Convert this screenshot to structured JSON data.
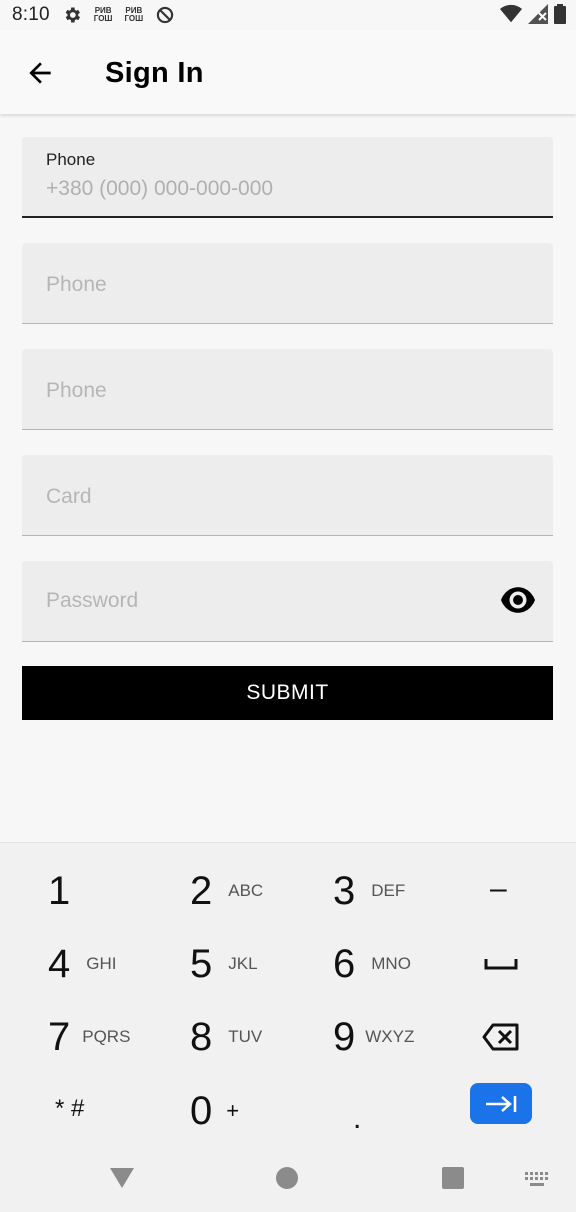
{
  "status_bar": {
    "time": "8:10",
    "icons": [
      "gear-icon",
      "sim-icon",
      "sim-icon",
      "no-sync-icon",
      "wifi-icon",
      "signal-icon",
      "battery-icon"
    ],
    "sim_label_top": "PИВ",
    "sim_label_bottom": "ГОШ"
  },
  "app_bar": {
    "title": "Sign In",
    "back_icon": "arrow-left-icon"
  },
  "form": {
    "phone_focused": {
      "label": "Phone",
      "value": "+380 (000) 000-000-000"
    },
    "phone_2": {
      "placeholder": "Phone"
    },
    "phone_3": {
      "placeholder": "Phone"
    },
    "card": {
      "placeholder": "Card"
    },
    "password": {
      "placeholder": "Password",
      "icon": "eye-icon"
    },
    "submit_label": "SUBMIT"
  },
  "keyboard": {
    "rows": [
      [
        {
          "num": "1",
          "sub": ""
        },
        {
          "num": "2",
          "sub": "ABC"
        },
        {
          "num": "3",
          "sub": "DEF"
        },
        {
          "sym": "–"
        }
      ],
      [
        {
          "num": "4",
          "sub": "GHI"
        },
        {
          "num": "5",
          "sub": "JKL"
        },
        {
          "num": "6",
          "sub": "MNO"
        },
        {
          "sym": "space-icon"
        }
      ],
      [
        {
          "num": "7",
          "sub": "PQRS"
        },
        {
          "num": "8",
          "sub": "TUV"
        },
        {
          "num": "9",
          "sub": "WXYZ"
        },
        {
          "sym": "backspace-icon"
        }
      ],
      [
        {
          "sym": "* #"
        },
        {
          "num": "0",
          "sub": "+"
        },
        {
          "sym": "."
        },
        {
          "sym": "tab-icon"
        }
      ]
    ],
    "accent_color": "#1a73e8"
  },
  "nav_bar": {
    "icons": [
      "nav-back-icon",
      "nav-home-icon",
      "nav-recents-icon",
      "keyboard-switch-icon"
    ]
  }
}
